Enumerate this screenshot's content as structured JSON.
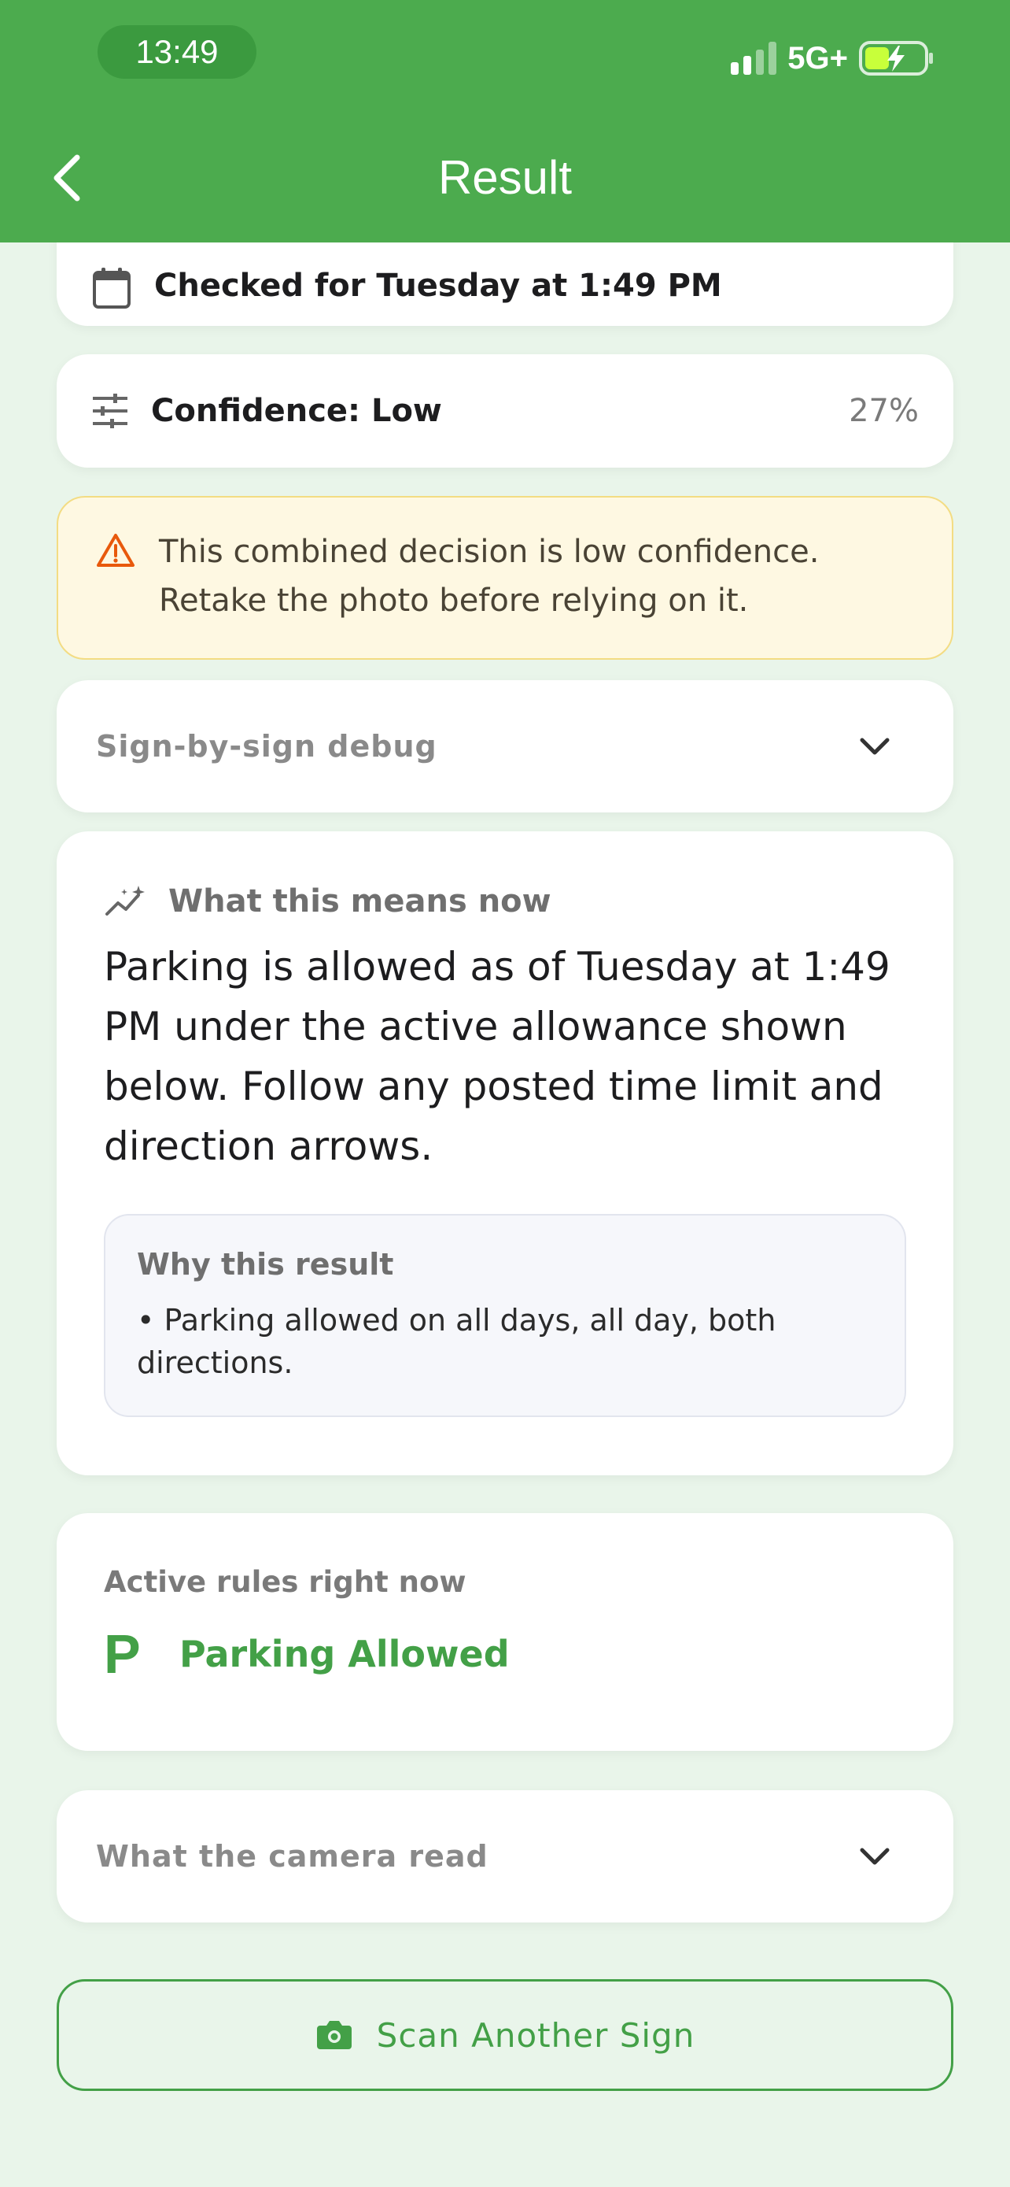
{
  "status_bar": {
    "time": "13:49",
    "network": "5G+"
  },
  "header": {
    "title": "Result"
  },
  "checked": {
    "text": "Checked for Tuesday at 1:49 PM"
  },
  "confidence": {
    "label": "Confidence: Low",
    "percent": "27%"
  },
  "warning": {
    "line1": "This combined decision is low confidence.",
    "line2": "Retake the photo before relying on it."
  },
  "debug": {
    "label": "Sign-by-sign debug"
  },
  "meaning": {
    "label": "What this means now",
    "text": "Parking is allowed as of Tuesday at 1:49 PM under the active allowance shown below. Follow any posted time limit and direction arrows.",
    "why_title": "Why this result",
    "why_items": [
      "• Parking allowed on all days, all day, both directions."
    ]
  },
  "active_rules": {
    "label": "Active rules right now",
    "rule_icon": "P",
    "rule_text": "Parking Allowed"
  },
  "camera": {
    "label": "What the camera read"
  },
  "scan_button": {
    "label": "Scan Another Sign"
  },
  "colors": {
    "brand_green": "#4cab4e",
    "accent_green": "#43a047",
    "warning_bg": "#fef8e2",
    "warning_icon": "#e8590c"
  }
}
